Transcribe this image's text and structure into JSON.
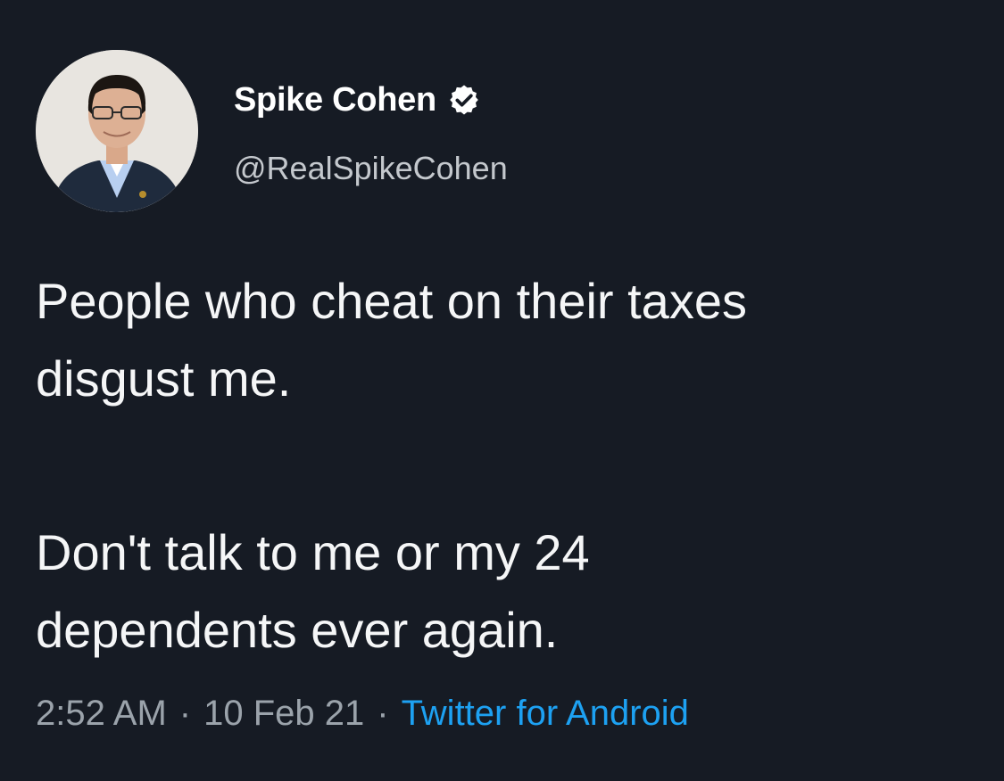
{
  "tweet": {
    "author": {
      "display_name": "Spike Cohen",
      "handle": "@RealSpikeCohen",
      "verified_icon": "verified-check-icon"
    },
    "text": {
      "paragraph_1": {
        "line_1": "People who cheat on their taxes",
        "line_2": "disgust me."
      },
      "paragraph_2": {
        "line_1": "Don't talk to me or my 24",
        "line_2": "dependents ever again."
      }
    },
    "meta": {
      "time": "2:52 AM",
      "date": "10 Feb 21",
      "separator": "·",
      "source": "Twitter for Android"
    }
  },
  "colors": {
    "background": "#161b24",
    "text_primary": "#f5f6f7",
    "text_secondary": "#9ba3ab",
    "link": "#1da1f2"
  }
}
